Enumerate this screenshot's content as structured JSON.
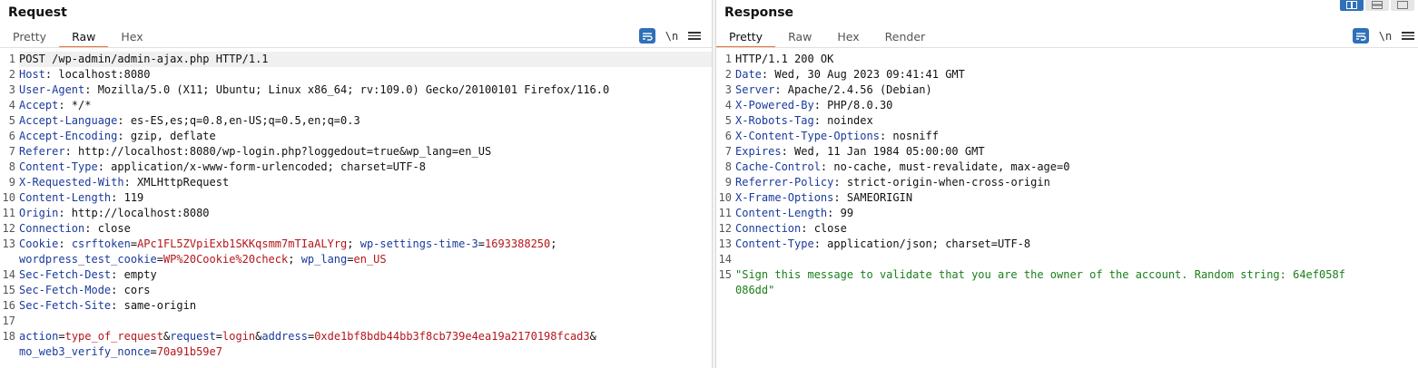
{
  "request": {
    "title": "Request",
    "tabs": [
      "Pretty",
      "Raw",
      "Hex"
    ],
    "active_tab": "Raw",
    "newline_label": "\\n",
    "lines": [
      {
        "n": "1",
        "parts": [
          [
            "v",
            "POST /wp-admin/admin-ajax.php HTTP/1.1"
          ]
        ]
      },
      {
        "n": "2",
        "parts": [
          [
            "k",
            "Host"
          ],
          [
            "v",
            ": localhost:8080"
          ]
        ]
      },
      {
        "n": "3",
        "parts": [
          [
            "k",
            "User-Agent"
          ],
          [
            "v",
            ": Mozilla/5.0 (X11; Ubuntu; Linux x86_64; rv:109.0) Gecko/20100101 Firefox/116.0"
          ]
        ]
      },
      {
        "n": "4",
        "parts": [
          [
            "k",
            "Accept"
          ],
          [
            "v",
            ": */*"
          ]
        ]
      },
      {
        "n": "5",
        "parts": [
          [
            "k",
            "Accept-Language"
          ],
          [
            "v",
            ": es-ES,es;q=0.8,en-US;q=0.5,en;q=0.3"
          ]
        ]
      },
      {
        "n": "6",
        "parts": [
          [
            "k",
            "Accept-Encoding"
          ],
          [
            "v",
            ": gzip, deflate"
          ]
        ]
      },
      {
        "n": "7",
        "parts": [
          [
            "k",
            "Referer"
          ],
          [
            "v",
            ": http://localhost:8080/wp-login.php?loggedout=true&wp_lang=en_US"
          ]
        ]
      },
      {
        "n": "8",
        "parts": [
          [
            "k",
            "Content-Type"
          ],
          [
            "v",
            ": application/x-www-form-urlencoded; charset=UTF-8"
          ]
        ]
      },
      {
        "n": "9",
        "parts": [
          [
            "k",
            "X-Requested-With"
          ],
          [
            "v",
            ": XMLHttpRequest"
          ]
        ]
      },
      {
        "n": "10",
        "parts": [
          [
            "k",
            "Content-Length"
          ],
          [
            "v",
            ": 119"
          ]
        ]
      },
      {
        "n": "11",
        "parts": [
          [
            "k",
            "Origin"
          ],
          [
            "v",
            ": http://localhost:8080"
          ]
        ]
      },
      {
        "n": "12",
        "parts": [
          [
            "k",
            "Connection"
          ],
          [
            "v",
            ": close"
          ]
        ]
      },
      {
        "n": "13",
        "parts": [
          [
            "k",
            "Cookie"
          ],
          [
            "v",
            ": "
          ],
          [
            "k",
            "csrftoken"
          ],
          [
            "v",
            "="
          ],
          [
            "cv",
            "APc1FL5ZVpiExb1SKKqsmm7mTIaALYrg"
          ],
          [
            "v",
            "; "
          ],
          [
            "k",
            "wp-settings-time-3"
          ],
          [
            "v",
            "="
          ],
          [
            "cv",
            "1693388250"
          ],
          [
            "v",
            ";"
          ]
        ]
      },
      {
        "n": "",
        "parts": [
          [
            "k",
            "wordpress_test_cookie"
          ],
          [
            "v",
            "="
          ],
          [
            "cv",
            "WP%20Cookie%20check"
          ],
          [
            "v",
            "; "
          ],
          [
            "k",
            "wp_lang"
          ],
          [
            "v",
            "="
          ],
          [
            "cv",
            "en_US"
          ]
        ]
      },
      {
        "n": "14",
        "parts": [
          [
            "k",
            "Sec-Fetch-Dest"
          ],
          [
            "v",
            ": empty"
          ]
        ]
      },
      {
        "n": "15",
        "parts": [
          [
            "k",
            "Sec-Fetch-Mode"
          ],
          [
            "v",
            ": cors"
          ]
        ]
      },
      {
        "n": "16",
        "parts": [
          [
            "k",
            "Sec-Fetch-Site"
          ],
          [
            "v",
            ": same-origin"
          ]
        ]
      },
      {
        "n": "17",
        "parts": []
      },
      {
        "n": "18",
        "parts": [
          [
            "k",
            "action"
          ],
          [
            "v",
            "="
          ],
          [
            "cv",
            "type_of_request"
          ],
          [
            "v",
            "&"
          ],
          [
            "k",
            "request"
          ],
          [
            "v",
            "="
          ],
          [
            "cv",
            "login"
          ],
          [
            "v",
            "&"
          ],
          [
            "k",
            "address"
          ],
          [
            "v",
            "="
          ],
          [
            "cv",
            "0xde1bf8bdb44bb3f8cb739e4ea19a2170198fcad3"
          ],
          [
            "v",
            "&"
          ]
        ]
      },
      {
        "n": "",
        "parts": [
          [
            "k",
            "mo_web3_verify_nonce"
          ],
          [
            "v",
            "="
          ],
          [
            "cv",
            "70a91b59e7"
          ]
        ]
      }
    ]
  },
  "response": {
    "title": "Response",
    "tabs": [
      "Pretty",
      "Raw",
      "Hex",
      "Render"
    ],
    "active_tab": "Pretty",
    "newline_label": "\\n",
    "lines": [
      {
        "n": "1",
        "parts": [
          [
            "v",
            "HTTP/1.1 200 OK"
          ]
        ]
      },
      {
        "n": "2",
        "parts": [
          [
            "k",
            "Date"
          ],
          [
            "v",
            ": Wed, 30 Aug 2023 09:41:41 GMT"
          ]
        ]
      },
      {
        "n": "3",
        "parts": [
          [
            "k",
            "Server"
          ],
          [
            "v",
            ": Apache/2.4.56 (Debian)"
          ]
        ]
      },
      {
        "n": "4",
        "parts": [
          [
            "k",
            "X-Powered-By"
          ],
          [
            "v",
            ": PHP/8.0.30"
          ]
        ]
      },
      {
        "n": "5",
        "parts": [
          [
            "k",
            "X-Robots-Tag"
          ],
          [
            "v",
            ": noindex"
          ]
        ]
      },
      {
        "n": "6",
        "parts": [
          [
            "k",
            "X-Content-Type-Options"
          ],
          [
            "v",
            ": nosniff"
          ]
        ]
      },
      {
        "n": "7",
        "parts": [
          [
            "k",
            "Expires"
          ],
          [
            "v",
            ": Wed, 11 Jan 1984 05:00:00 GMT"
          ]
        ]
      },
      {
        "n": "8",
        "parts": [
          [
            "k",
            "Cache-Control"
          ],
          [
            "v",
            ": no-cache, must-revalidate, max-age=0"
          ]
        ]
      },
      {
        "n": "9",
        "parts": [
          [
            "k",
            "Referrer-Policy"
          ],
          [
            "v",
            ": strict-origin-when-cross-origin"
          ]
        ]
      },
      {
        "n": "10",
        "parts": [
          [
            "k",
            "X-Frame-Options"
          ],
          [
            "v",
            ": SAMEORIGIN"
          ]
        ]
      },
      {
        "n": "11",
        "parts": [
          [
            "k",
            "Content-Length"
          ],
          [
            "v",
            ": 99"
          ]
        ]
      },
      {
        "n": "12",
        "parts": [
          [
            "k",
            "Connection"
          ],
          [
            "v",
            ": close"
          ]
        ]
      },
      {
        "n": "13",
        "parts": [
          [
            "k",
            "Content-Type"
          ],
          [
            "v",
            ": application/json; charset=UTF-8"
          ]
        ]
      },
      {
        "n": "14",
        "parts": []
      },
      {
        "n": "15",
        "parts": [
          [
            "s",
            "\"Sign this message to validate that you are the owner of the account. Random string: 64ef058f"
          ]
        ]
      },
      {
        "n": "",
        "parts": [
          [
            "s",
            "086dd\""
          ]
        ]
      }
    ]
  },
  "colors": {
    "accent": "#e8733c",
    "button_blue": "#2f70b8",
    "key": "#1a3a9c",
    "cookie_value": "#b5161b",
    "string": "#1a7f1a"
  }
}
